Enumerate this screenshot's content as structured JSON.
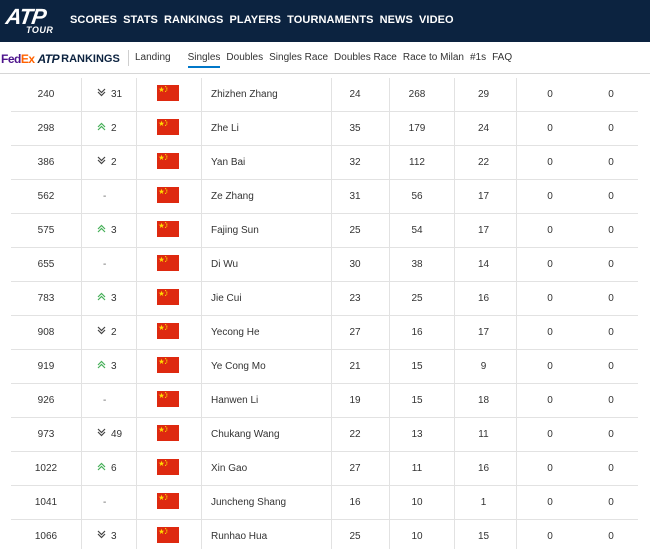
{
  "header": {
    "logo_text": "ATP",
    "logo_sub": "TOUR",
    "nav": [
      "SCORES",
      "STATS",
      "RANKINGS",
      "PLAYERS",
      "TOURNAMENTS",
      "NEWS",
      "VIDEO"
    ]
  },
  "subheader": {
    "brand_fe": "Fed",
    "brand_ex": "Ex",
    "brand_atp": "ATP",
    "brand_rankings": "RANKINGS",
    "tabs": [
      "Landing",
      "Singles",
      "Doubles",
      "Singles Race",
      "Doubles Race",
      "Race to Milan",
      "#1s",
      "FAQ"
    ],
    "active_tab": "Singles"
  },
  "colors": {
    "nav_bg": "#0c2340",
    "flag_red": "#de2910",
    "flag_star": "#ffde00",
    "move_up": "#47b05a",
    "tab_underline": "#0077c8"
  },
  "rows": [
    {
      "rank": "240",
      "dir": "down",
      "move": "31",
      "flag": "china-flag",
      "name": "Zhizhen Zhang",
      "age": "24",
      "points": "268",
      "tourn": "29",
      "dropping": "0",
      "next_best": "0"
    },
    {
      "rank": "298",
      "dir": "up",
      "move": "2",
      "flag": "china-flag",
      "name": "Zhe Li",
      "age": "35",
      "points": "179",
      "tourn": "24",
      "dropping": "0",
      "next_best": "0"
    },
    {
      "rank": "386",
      "dir": "down",
      "move": "2",
      "flag": "china-flag",
      "name": "Yan Bai",
      "age": "32",
      "points": "112",
      "tourn": "22",
      "dropping": "0",
      "next_best": "0"
    },
    {
      "rank": "562",
      "dir": "none",
      "move": "-",
      "flag": "china-flag",
      "name": "Ze Zhang",
      "age": "31",
      "points": "56",
      "tourn": "17",
      "dropping": "0",
      "next_best": "0"
    },
    {
      "rank": "575",
      "dir": "up",
      "move": "3",
      "flag": "china-flag",
      "name": "Fajing Sun",
      "age": "25",
      "points": "54",
      "tourn": "17",
      "dropping": "0",
      "next_best": "0"
    },
    {
      "rank": "655",
      "dir": "none",
      "move": "-",
      "flag": "china-flag",
      "name": "Di Wu",
      "age": "30",
      "points": "38",
      "tourn": "14",
      "dropping": "0",
      "next_best": "0"
    },
    {
      "rank": "783",
      "dir": "up",
      "move": "3",
      "flag": "china-flag",
      "name": "Jie Cui",
      "age": "23",
      "points": "25",
      "tourn": "16",
      "dropping": "0",
      "next_best": "0"
    },
    {
      "rank": "908",
      "dir": "down",
      "move": "2",
      "flag": "china-flag",
      "name": "Yecong He",
      "age": "27",
      "points": "16",
      "tourn": "17",
      "dropping": "0",
      "next_best": "0"
    },
    {
      "rank": "919",
      "dir": "up",
      "move": "3",
      "flag": "china-flag",
      "name": "Ye Cong Mo",
      "age": "21",
      "points": "15",
      "tourn": "9",
      "dropping": "0",
      "next_best": "0"
    },
    {
      "rank": "926",
      "dir": "none",
      "move": "-",
      "flag": "china-flag",
      "name": "Hanwen Li",
      "age": "19",
      "points": "15",
      "tourn": "18",
      "dropping": "0",
      "next_best": "0"
    },
    {
      "rank": "973",
      "dir": "down",
      "move": "49",
      "flag": "china-flag",
      "name": "Chukang Wang",
      "age": "22",
      "points": "13",
      "tourn": "11",
      "dropping": "0",
      "next_best": "0"
    },
    {
      "rank": "1022",
      "dir": "up",
      "move": "6",
      "flag": "china-flag",
      "name": "Xin Gao",
      "age": "27",
      "points": "11",
      "tourn": "16",
      "dropping": "0",
      "next_best": "0"
    },
    {
      "rank": "1041",
      "dir": "none",
      "move": "-",
      "flag": "china-flag",
      "name": "Juncheng Shang",
      "age": "16",
      "points": "10",
      "tourn": "1",
      "dropping": "0",
      "next_best": "0"
    },
    {
      "rank": "1066",
      "dir": "down",
      "move": "3",
      "flag": "china-flag",
      "name": "Runhao Hua",
      "age": "25",
      "points": "10",
      "tourn": "15",
      "dropping": "0",
      "next_best": "0"
    }
  ]
}
